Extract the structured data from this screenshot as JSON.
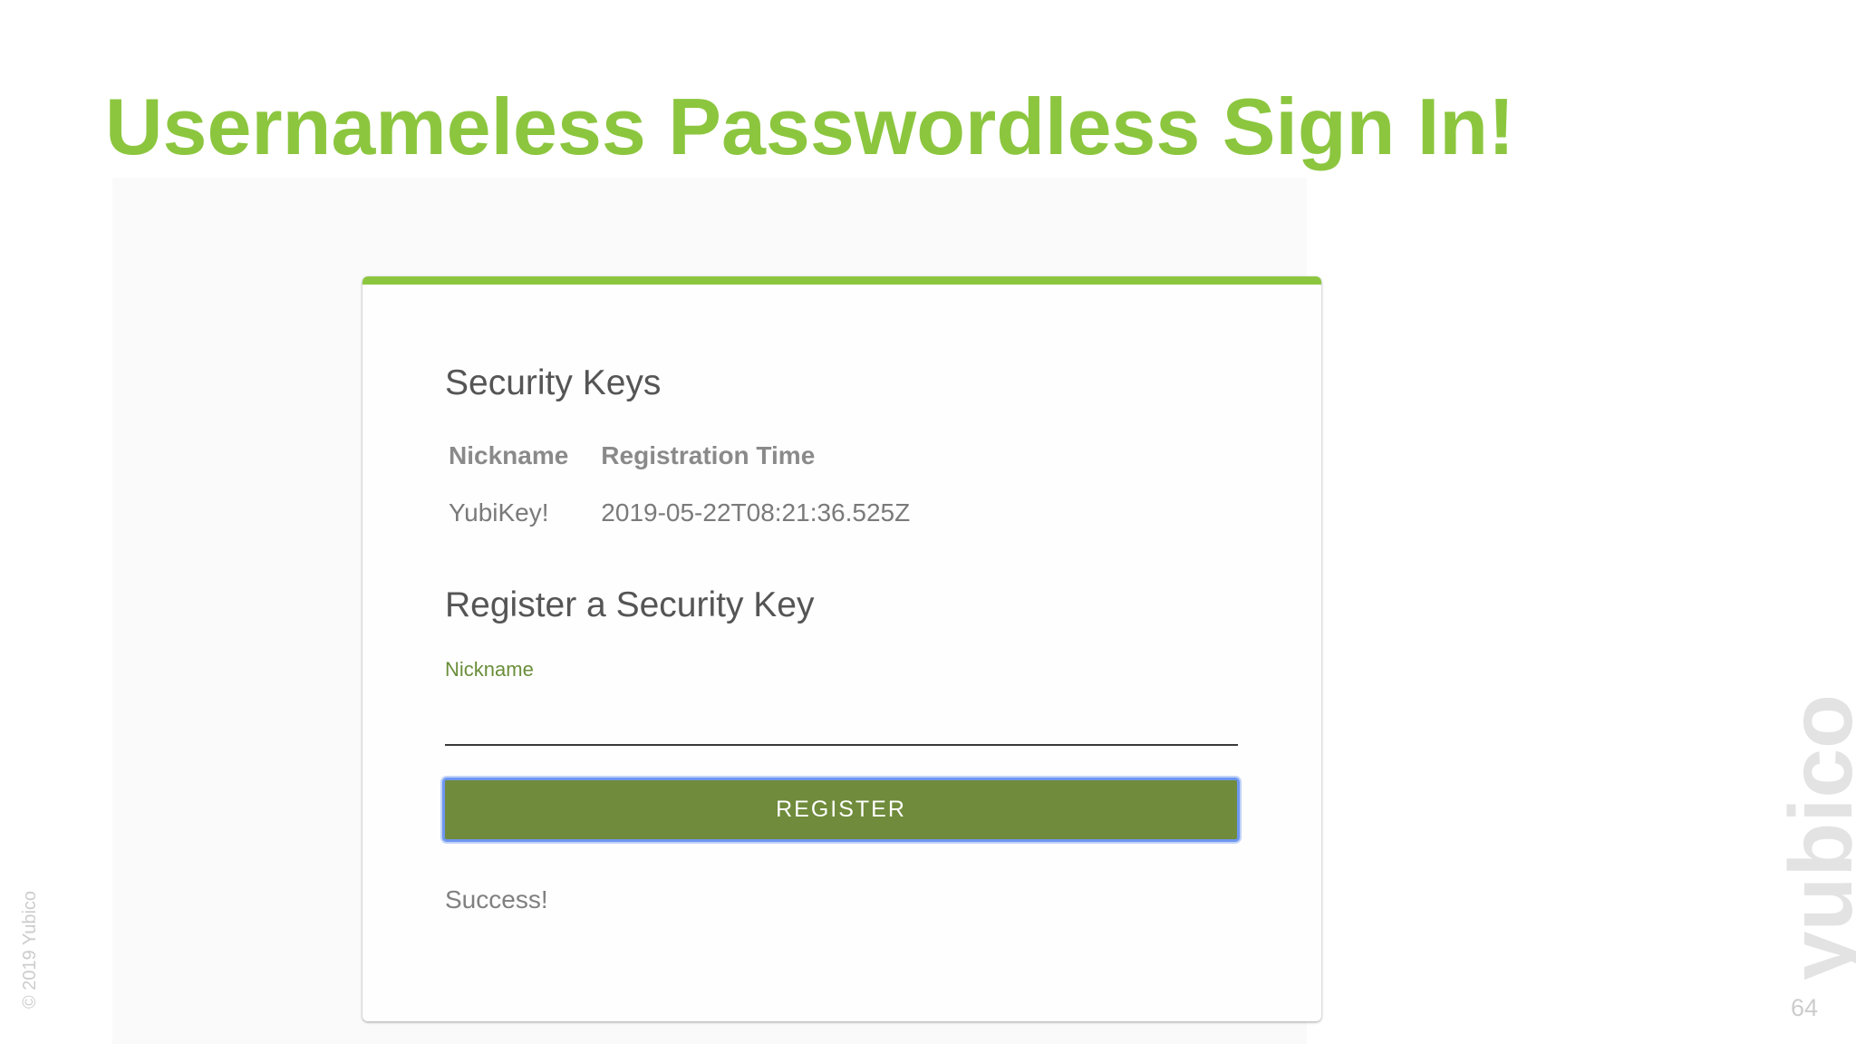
{
  "slide": {
    "title": "Usernameless Passwordless Sign In!",
    "copyright": "© 2019 Yubico",
    "logo_text": "yubico",
    "page_number": "64",
    "accent_color": "#8cc63f"
  },
  "card": {
    "security_keys": {
      "heading": "Security Keys",
      "columns": [
        "Nickname",
        "Registration Time"
      ],
      "rows": [
        {
          "nickname": "YubiKey!",
          "registration_time": "2019-05-22T08:21:36.525Z"
        }
      ]
    },
    "register": {
      "heading": "Register a Security Key",
      "nickname_label": "Nickname",
      "nickname_value": "",
      "button_label": "REGISTER",
      "button_color": "#6f8b3b",
      "focus_ring_color": "#6e96f0",
      "status": "Success!"
    }
  }
}
